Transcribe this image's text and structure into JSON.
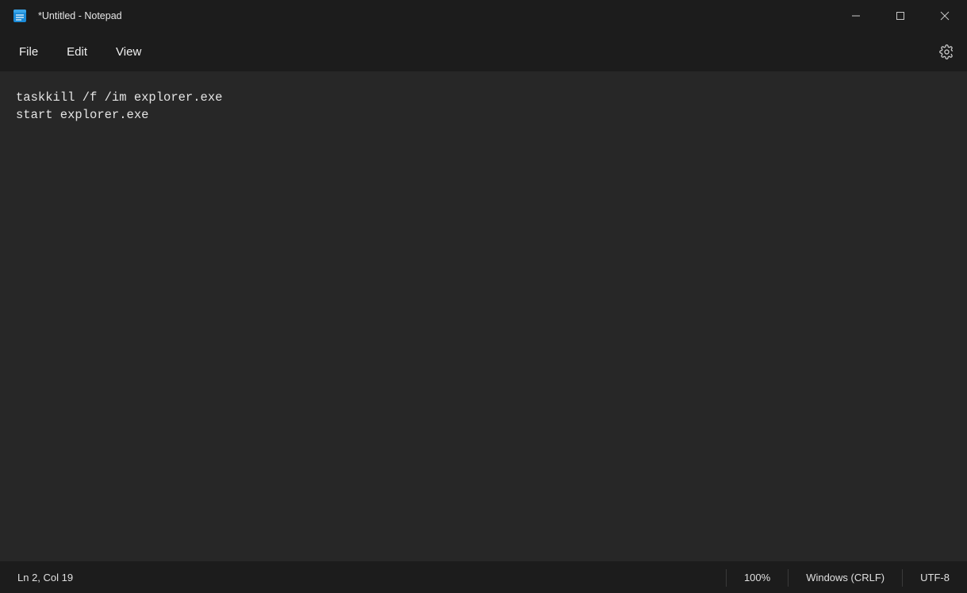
{
  "window": {
    "title": "*Untitled - Notepad"
  },
  "menu": {
    "file": "File",
    "edit": "Edit",
    "view": "View"
  },
  "editor": {
    "content": "taskkill /f /im explorer.exe\nstart explorer.exe"
  },
  "status": {
    "position": "Ln 2, Col 19",
    "zoom": "100%",
    "lineending": "Windows (CRLF)",
    "encoding": "UTF-8"
  }
}
